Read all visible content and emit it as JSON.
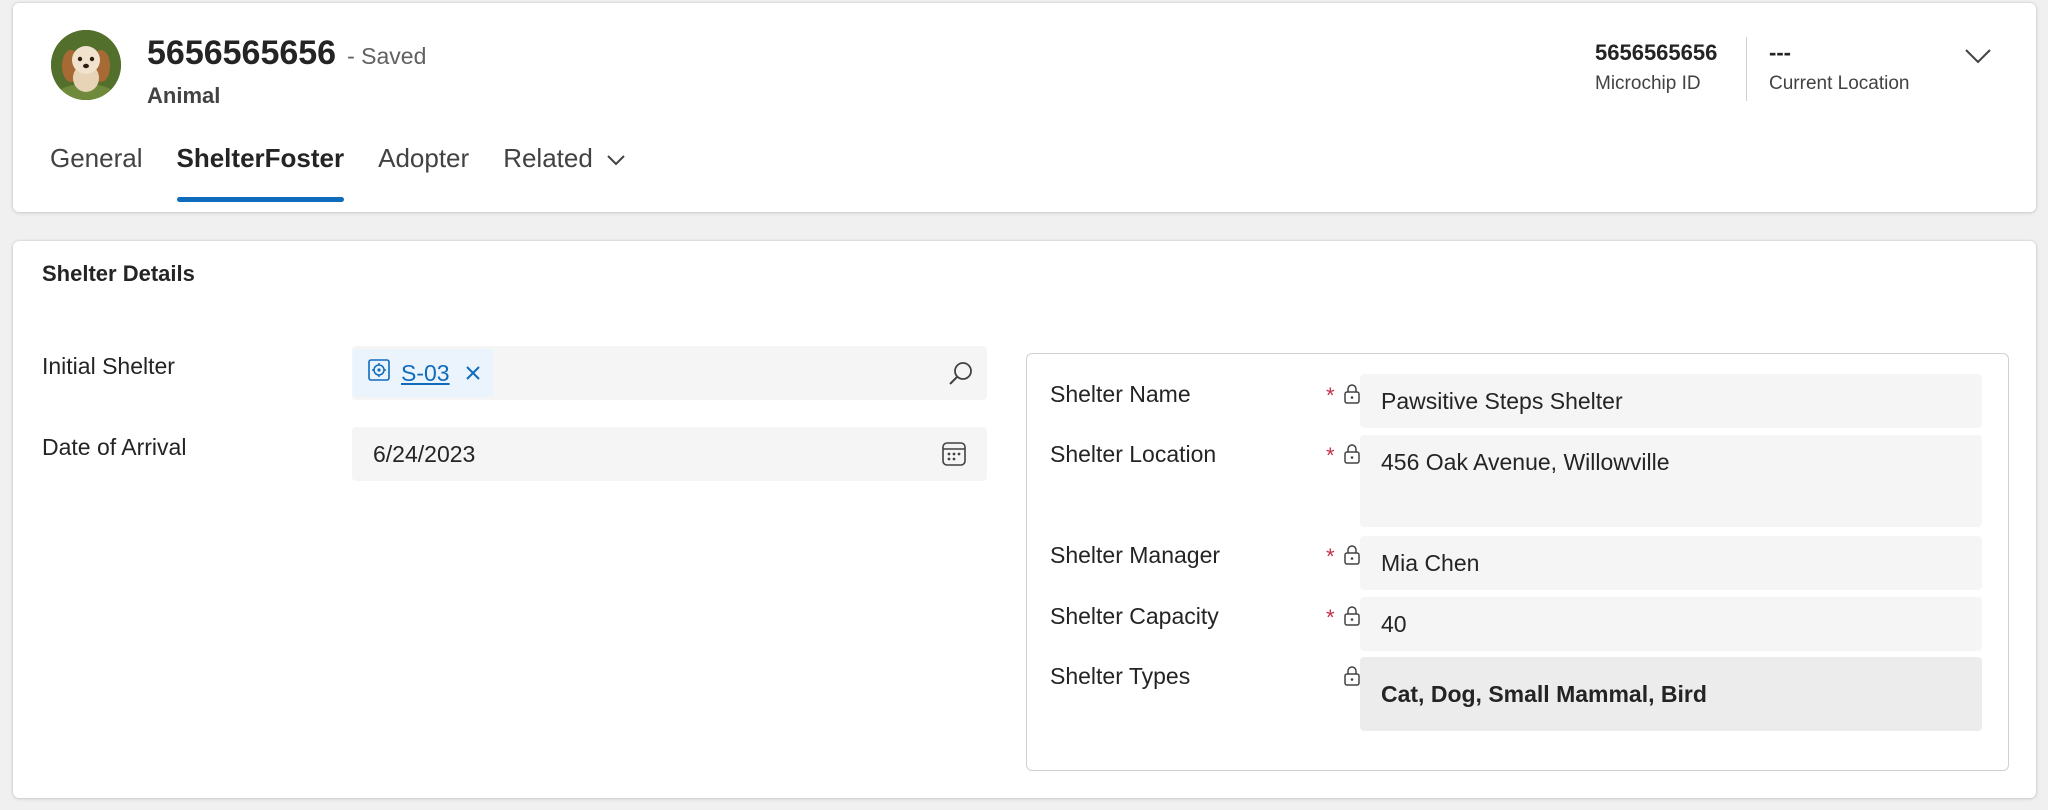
{
  "header": {
    "record_number": "5656565656",
    "saved_status": "- Saved",
    "entity_type": "Animal",
    "fields": [
      {
        "value": "5656565656",
        "label": "Microchip ID"
      },
      {
        "value": "---",
        "label": "Current Location"
      }
    ],
    "tabs": [
      {
        "label": "General",
        "active": false
      },
      {
        "label": "ShelterFoster",
        "active": true
      },
      {
        "label": "Adopter",
        "active": false
      },
      {
        "label": "Related",
        "active": false
      }
    ]
  },
  "section": {
    "title": "Shelter Details",
    "initial_shelter": {
      "label": "Initial Shelter",
      "value": "S-03"
    },
    "date_of_arrival": {
      "label": "Date of Arrival",
      "value": "6/24/2023"
    }
  },
  "quick_view": {
    "rows": [
      {
        "label": "Shelter Name",
        "value": "Pawsitive Steps Shelter",
        "required": "*"
      },
      {
        "label": "Shelter Location",
        "value": "456 Oak Avenue, Willowville",
        "required": "*"
      },
      {
        "label": "Shelter Manager",
        "value": "Mia Chen",
        "required": "*"
      },
      {
        "label": "Shelter Capacity",
        "value": "40",
        "required": "*"
      },
      {
        "label": "Shelter Types",
        "value": "Cat, Dog, Small Mammal, Bird",
        "required": ""
      }
    ]
  },
  "colors": {
    "accent": "#0f6cbd",
    "required": "#c4314b",
    "field_bg": "#f5f5f5"
  },
  "icons": [
    "dog-avatar",
    "chevron-down-icon",
    "entity-icon",
    "close-icon",
    "search-icon",
    "calendar-icon",
    "lock-icon"
  ]
}
